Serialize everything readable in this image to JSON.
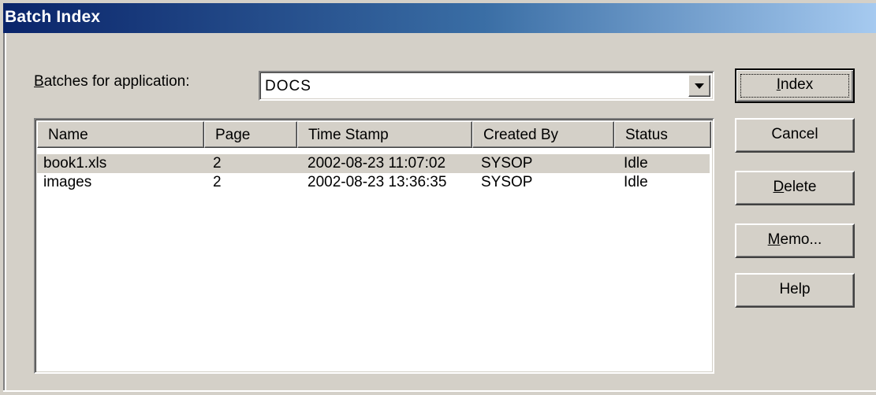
{
  "window": {
    "title": "Batch Index"
  },
  "application": {
    "label_mnemonic": "B",
    "label_rest": "atches for application:",
    "selected_value": "DOCS"
  },
  "list": {
    "columns": [
      "Name",
      "Page",
      "Time Stamp",
      "Created By",
      "Status"
    ],
    "rows": [
      {
        "name": "book1.xls",
        "page": "2",
        "timestamp": "2002-08-23 11:07:02",
        "created_by": "SYSOP",
        "status": "Idle",
        "selected": true
      },
      {
        "name": "images",
        "page": "2",
        "timestamp": "2002-08-23 13:36:35",
        "created_by": "SYSOP",
        "status": "Idle",
        "selected": false
      }
    ]
  },
  "buttons": {
    "index": {
      "mnemonic": "I",
      "rest": "ndex"
    },
    "cancel": {
      "label": "Cancel"
    },
    "delete": {
      "mnemonic": "D",
      "rest": "elete"
    },
    "memo": {
      "mnemonic": "M",
      "rest": "emo..."
    },
    "help": {
      "label": "Help"
    }
  },
  "icons": {
    "dropdown": "chevron-down-icon"
  },
  "colors": {
    "face": "#d4d0c8",
    "title_start": "#0a246a",
    "title_end": "#a6caf0"
  }
}
